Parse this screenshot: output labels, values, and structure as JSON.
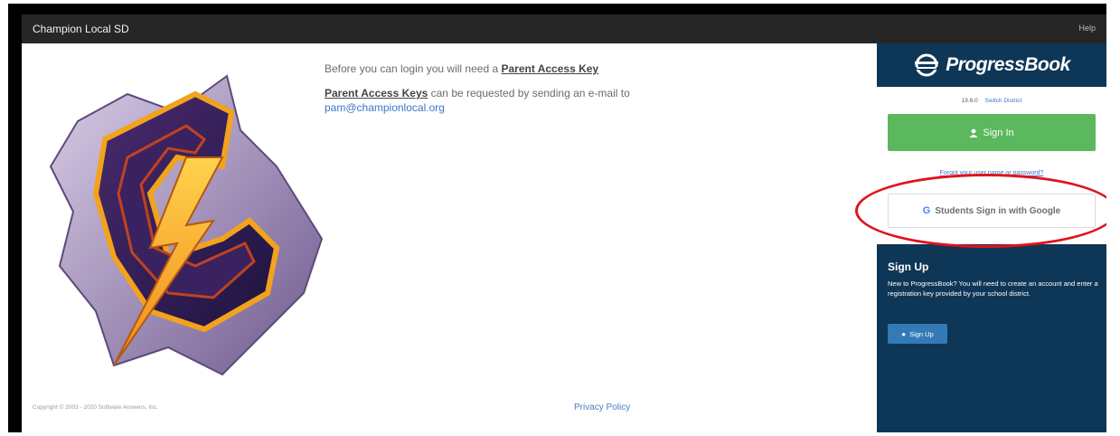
{
  "header": {
    "title": "Champion Local SD",
    "help": "Help"
  },
  "info": {
    "line1_prefix": "Before you can login you will need a ",
    "line1_link": "Parent Access Key",
    "line2_link": "Parent Access Keys",
    "line2_suffix": " can be requested by sending an e-mail to",
    "email": "pam@championlocal.org"
  },
  "footer": {
    "copyright": "Copyright © 2003 - 2020 Software Answers, Inc.",
    "privacy": "Privacy Policy"
  },
  "panel": {
    "brand": "ProgressBook",
    "version": "19.6.0",
    "switch_district": "Switch District",
    "sign_in": "Sign In",
    "forgot": "Forgot your user name or password?",
    "google_sign_in": "Students Sign in with Google",
    "signup_title": "Sign Up",
    "signup_desc": "New to ProgressBook? You will need to create an account and enter a registration key provided by your school district.",
    "signup_button": "Sign Up"
  },
  "colors": {
    "topbar": "#262626",
    "panel": "#0e3656",
    "signin_green": "#5cb85c",
    "signup_blue": "#337ab7",
    "highlight_red": "#e0131b"
  }
}
